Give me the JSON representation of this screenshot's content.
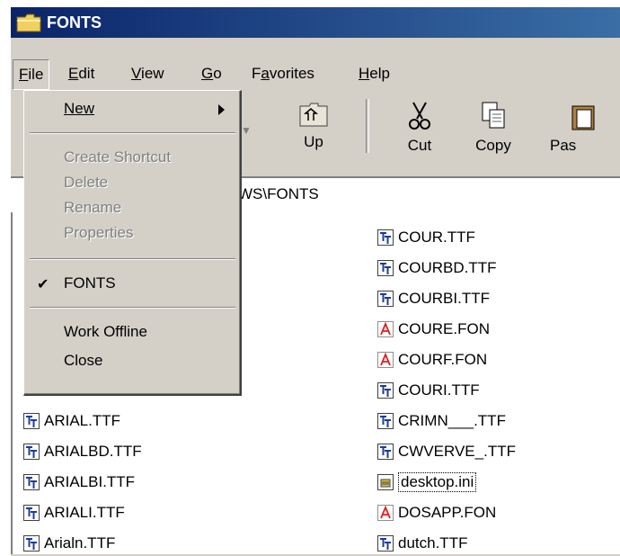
{
  "window": {
    "title": "FONTS"
  },
  "menubar": [
    "File",
    "Edit",
    "View",
    "Go",
    "Favorites",
    "Help"
  ],
  "menu_mnemonics": [
    "F",
    "E",
    "V",
    "G",
    "a",
    "H"
  ],
  "file_menu": {
    "new": "New",
    "create_shortcut": "Create Shortcut",
    "delete": "Delete",
    "rename": "Rename",
    "properties": "Properties",
    "fonts": "FONTS",
    "work_offline": "Work Offline",
    "close": "Close"
  },
  "toolbar": {
    "up": "Up",
    "cut": "Cut",
    "copy": "Copy",
    "paste": "Pas"
  },
  "address": {
    "value": "WS\\FONTS"
  },
  "files_left": [
    {
      "name": "ARIAL.TTF",
      "icon": "truetype-font-icon"
    },
    {
      "name": "ARIALBD.TTF",
      "icon": "truetype-font-icon"
    },
    {
      "name": "ARIALBI.TTF",
      "icon": "truetype-font-icon"
    },
    {
      "name": "ARIALI.TTF",
      "icon": "truetype-font-icon"
    },
    {
      "name": "Arialn.TTF",
      "icon": "truetype-font-icon"
    }
  ],
  "files_right": [
    {
      "name": "COUR.TTF",
      "icon": "truetype-font-icon"
    },
    {
      "name": "COURBD.TTF",
      "icon": "truetype-font-icon"
    },
    {
      "name": "COURBI.TTF",
      "icon": "truetype-font-icon"
    },
    {
      "name": "COURE.FON",
      "icon": "bitmap-font-icon"
    },
    {
      "name": "COURF.FON",
      "icon": "bitmap-font-icon"
    },
    {
      "name": "COURI.TTF",
      "icon": "truetype-font-icon"
    },
    {
      "name": "CRIMN___.TTF",
      "icon": "truetype-font-icon"
    },
    {
      "name": "CWVERVE_.TTF",
      "icon": "truetype-font-icon"
    },
    {
      "name": "desktop.ini",
      "icon": "settings-file-icon"
    },
    {
      "name": "DOSAPP.FON",
      "icon": "bitmap-font-icon"
    },
    {
      "name": "dutch.TTF",
      "icon": "truetype-font-icon"
    }
  ],
  "colors": {
    "titlebar": "#0a246a",
    "face": "#d4d0c8",
    "disabled_text": "#808080"
  }
}
